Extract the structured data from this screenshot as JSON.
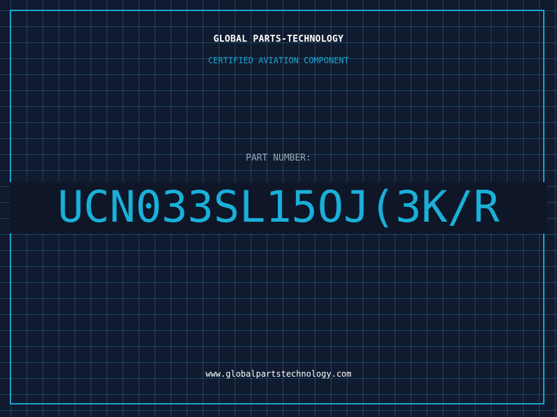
{
  "header": {
    "brand": "GLOBAL PARTS-TECHNOLOGY",
    "subtitle": "CERTIFIED AVIATION COMPONENT"
  },
  "part": {
    "label": "PART NUMBER:",
    "number": "UCN033SL15OJ(3K/R"
  },
  "footer": {
    "website": "www.globalpartstechnology.com"
  },
  "colors": {
    "background": "#111a2e",
    "accent": "#1aa5cf",
    "grid": "#1e6e8c",
    "text": "#ffffff",
    "muted": "#9aa6b8"
  }
}
